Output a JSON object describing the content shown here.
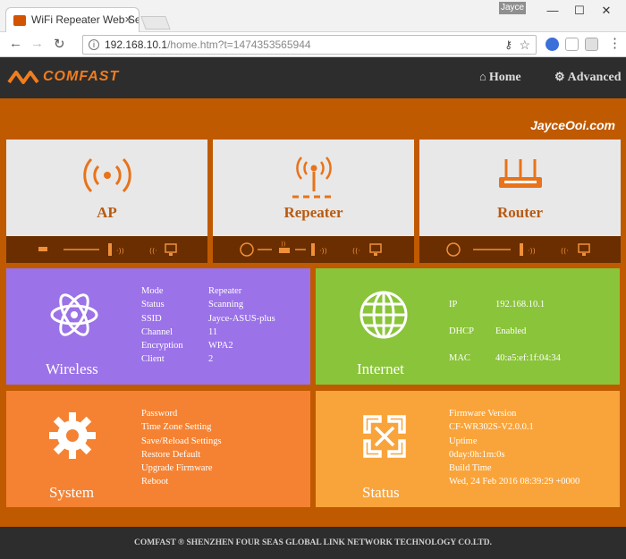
{
  "browser": {
    "tab_title": "WiFi Repeater Web Serve",
    "tab_close": "×",
    "user": "Jayce",
    "url_host": "192.168.10.1",
    "url_path": "/home.htm?t=1474353565944",
    "controls": {
      "minimize": "—",
      "maximize": "☐",
      "close": "✕"
    }
  },
  "header": {
    "brand": "COMFAST",
    "nav": [
      {
        "icon": "home-icon",
        "label": "Home"
      },
      {
        "icon": "gear-icon",
        "label": "Advanced"
      }
    ]
  },
  "watermark": "JayceOoi.com",
  "modes": [
    {
      "label": "AP",
      "icon": "broadcast-icon"
    },
    {
      "label": "Repeater",
      "icon": "tower-icon"
    },
    {
      "label": "Router",
      "icon": "router-icon"
    }
  ],
  "wireless": {
    "title": "Wireless",
    "keys": [
      "Mode",
      "Status",
      "SSID",
      "Channel",
      "Encryption",
      "Client"
    ],
    "values": [
      "Repeater",
      "Scanning",
      "Jayce-ASUS-plus",
      "11",
      "WPA2",
      "2"
    ],
    "color": "#9b72e8"
  },
  "internet": {
    "title": "Internet",
    "keys": [
      "IP",
      "DHCP",
      "MAC"
    ],
    "values": [
      "192.168.10.1",
      "Enabled",
      "40:a5:ef:1f:04:34"
    ],
    "color": "#8ac43a"
  },
  "system": {
    "title": "System",
    "links": [
      "Password",
      "Time Zone Setting",
      "Save/Reload Settings",
      "Restore Default",
      "Upgrade Firmware",
      "Reboot"
    ],
    "color": "#f58232"
  },
  "status": {
    "title": "Status",
    "lines": [
      "Firmware Version",
      "CF-WR302S-V2.0.0.1",
      "Uptime",
      "0day:0h:1m:0s",
      "Build Time",
      "Wed, 24 Feb 2016 08:39:29 +0000"
    ],
    "color": "#f9a43a"
  },
  "footer": "COMFAST ® SHENZHEN FOUR SEAS GLOBAL LINK NETWORK TECHNOLOGY CO.LTD."
}
